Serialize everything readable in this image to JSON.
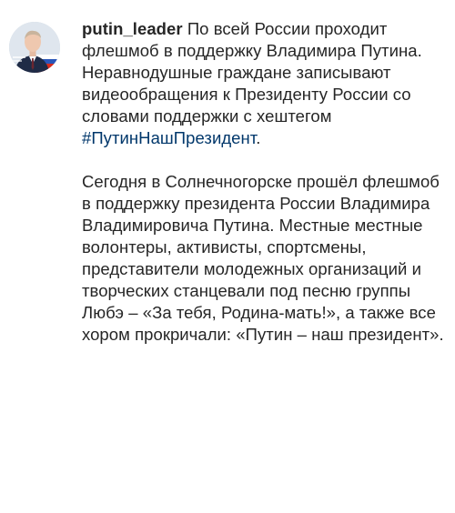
{
  "post": {
    "username": "putin_leader",
    "paragraph1_text": "По всей России проходит флешмоб в поддержку Владимира Путина. Неравнодушные граждане записывают видеообращения к Президенту России со словами поддержки с хештегом ",
    "hashtag": "#ПутинНашПрезидент",
    "paragraph1_end": ".",
    "paragraph2_text": "Сегодня в Солнечногорске прошёл флешмоб в поддержку президента России Владимира Владимировича Путина. Местные местные волонтеры, активисты, спортсмены, представители молодежных организаций и творческих станцевали под песню группы Любэ – «За тебя, Родина-мать!», а также все хором прокричали: «Путин – наш президент»."
  },
  "colors": {
    "text": "#262626",
    "hashtag": "#00376b",
    "avatar_background": "#dfe6ee"
  },
  "icons": {
    "avatar": "profile-photo-avatar"
  }
}
